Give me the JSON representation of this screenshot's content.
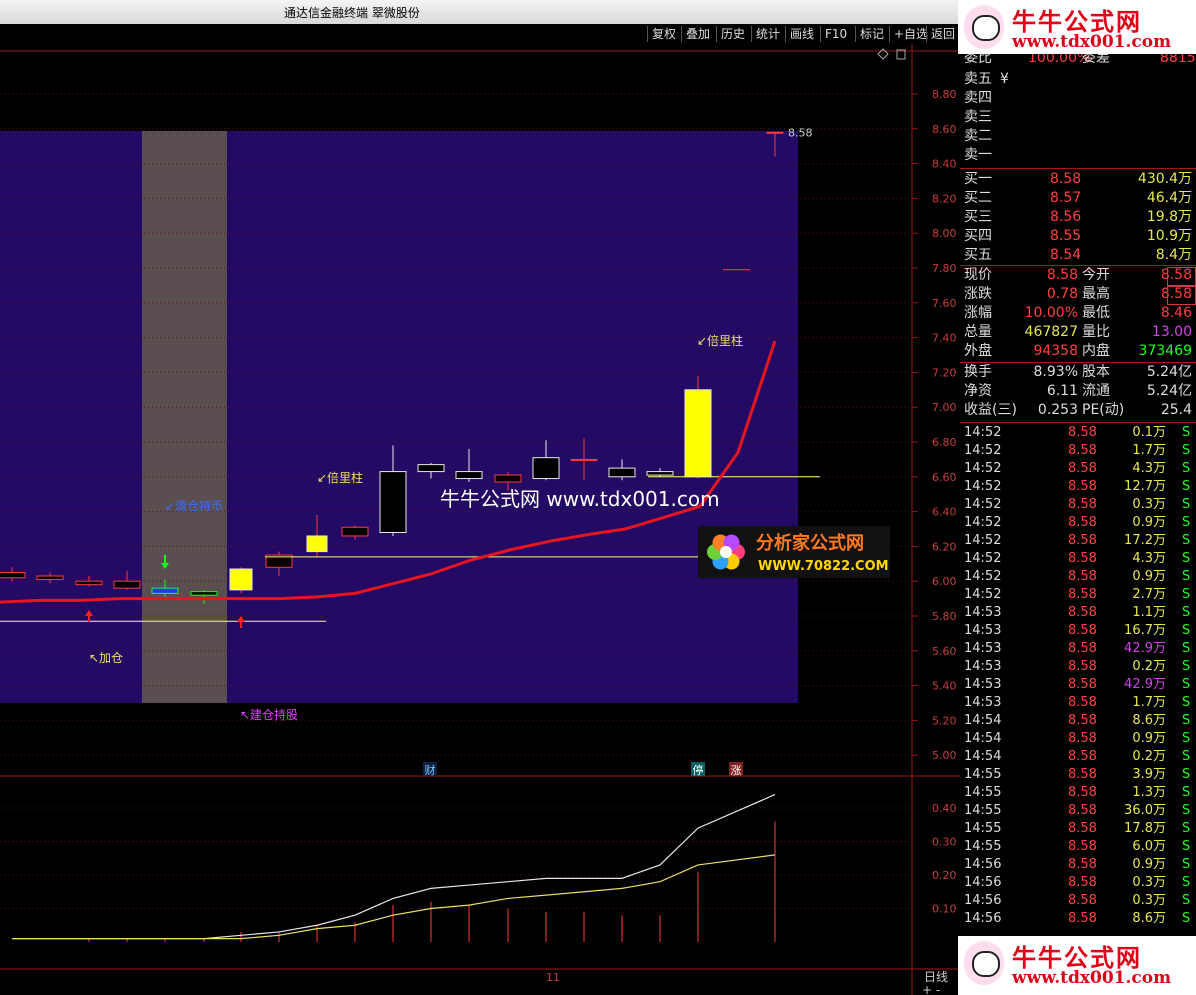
{
  "window": {
    "title": "通达信金融终端  翠微股份"
  },
  "toolbar": {
    "items": [
      "复权",
      "叠加",
      "历史",
      "统计",
      "画线",
      "F10",
      "标记",
      "+自选",
      "返回"
    ]
  },
  "price_axis": {
    "labels": [
      "8.80",
      "8.60",
      "8.40",
      "8.20",
      "8.00",
      "7.80",
      "7.60",
      "7.40",
      "7.20",
      "7.00",
      "6.80",
      "6.60",
      "6.40",
      "6.20",
      "6.00",
      "5.80",
      "5.60",
      "5.40",
      "5.20",
      "5.00"
    ]
  },
  "volume_axis": {
    "labels": [
      "0.40",
      "0.30",
      "0.20",
      "0.10"
    ]
  },
  "annotations": {
    "limit_price": "8.58",
    "bei_liang_zhu": "↙倍里柱",
    "bei_liang_zhu_2": "↙倍里柱",
    "qing_cang": "↙清仓持币",
    "jia_cang": "↖加仓",
    "jian_cang": "↖建仓持股",
    "watermark_url": "牛牛公式网 www.tdx001.com",
    "logo_name": "分析家公式网",
    "logo_url": "WWW.70822.COM",
    "marker_cai": "财",
    "marker_ting": "停",
    "marker_zhang": "涨",
    "date_label": "11",
    "bottom_tab": "日线",
    "bottom_symbols": "+  -"
  },
  "order_book": {
    "header": [
      "委比",
      "100.00%",
      "委差",
      "8815"
    ],
    "sell": [
      "卖五",
      "卖四",
      "卖三",
      "卖二",
      "卖一"
    ],
    "sell_extra": "¥",
    "buy": [
      {
        "label": "买一",
        "price": "8.58",
        "vol": "430.4万"
      },
      {
        "label": "买二",
        "price": "8.57",
        "vol": "46.4万"
      },
      {
        "label": "买三",
        "price": "8.56",
        "vol": "19.8万"
      },
      {
        "label": "买四",
        "price": "8.55",
        "vol": "10.9万"
      },
      {
        "label": "买五",
        "price": "8.54",
        "vol": "8.4万"
      }
    ]
  },
  "quote": [
    {
      "l1": "现价",
      "v1": "8.58",
      "l2": "今开",
      "v2": "8.58"
    },
    {
      "l1": "涨跌",
      "v1": "0.78",
      "l2": "最高",
      "v2": "8.58"
    },
    {
      "l1": "涨幅",
      "v1": "10.00%",
      "l2": "最低",
      "v2": "8.46"
    },
    {
      "l1": "总量",
      "v1": "467827",
      "l2": "量比",
      "v2": "13.00"
    },
    {
      "l1": "外盘",
      "v1": "94358",
      "l2": "内盘",
      "v2": "373469"
    }
  ],
  "fundamentals": [
    {
      "l1": "换手",
      "v1": "8.93%",
      "l2": "股本",
      "v2": "5.24亿"
    },
    {
      "l1": "净资",
      "v1": "6.11",
      "l2": "流通",
      "v2": "5.24亿"
    },
    {
      "l1": "收益(三)",
      "v1": "0.253",
      "l2": "PE(动)",
      "v2": "25.4"
    }
  ],
  "ticks": [
    [
      "14:52",
      "8.58",
      "0.1万",
      "S"
    ],
    [
      "14:52",
      "8.58",
      "1.7万",
      "S"
    ],
    [
      "14:52",
      "8.58",
      "4.3万",
      "S"
    ],
    [
      "14:52",
      "8.58",
      "12.7万",
      "S"
    ],
    [
      "14:52",
      "8.58",
      "0.3万",
      "S"
    ],
    [
      "14:52",
      "8.58",
      "0.9万",
      "S"
    ],
    [
      "14:52",
      "8.58",
      "17.2万",
      "S"
    ],
    [
      "14:52",
      "8.58",
      "4.3万",
      "S"
    ],
    [
      "14:52",
      "8.58",
      "0.9万",
      "S"
    ],
    [
      "14:52",
      "8.58",
      "2.7万",
      "S"
    ],
    [
      "14:53",
      "8.58",
      "1.1万",
      "S"
    ],
    [
      "14:53",
      "8.58",
      "16.7万",
      "S"
    ],
    [
      "14:53",
      "8.58",
      "42.9万",
      "S"
    ],
    [
      "14:53",
      "8.58",
      "0.2万",
      "S"
    ],
    [
      "14:53",
      "8.58",
      "42.9万",
      "S"
    ],
    [
      "14:53",
      "8.58",
      "1.7万",
      "S"
    ],
    [
      "14:54",
      "8.58",
      "8.6万",
      "S"
    ],
    [
      "14:54",
      "8.58",
      "0.9万",
      "S"
    ],
    [
      "14:54",
      "8.58",
      "0.2万",
      "S"
    ],
    [
      "14:55",
      "8.58",
      "3.9万",
      "S"
    ],
    [
      "14:55",
      "8.58",
      "1.3万",
      "S"
    ],
    [
      "14:55",
      "8.58",
      "36.0万",
      "S"
    ],
    [
      "14:55",
      "8.58",
      "17.8万",
      "S"
    ],
    [
      "14:55",
      "8.58",
      "6.0万",
      "S"
    ],
    [
      "14:56",
      "8.58",
      "0.9万",
      "S"
    ],
    [
      "14:56",
      "8.58",
      "0.3万",
      "S"
    ],
    [
      "14:56",
      "8.58",
      "0.3万",
      "S"
    ],
    [
      "14:56",
      "8.58",
      "8.6万",
      "S"
    ]
  ],
  "tick_highlight_indices": [
    12,
    14
  ],
  "watermark": {
    "brand": "牛牛公式网",
    "url": "www.tdx001.com"
  },
  "chart_data": {
    "type": "candlestick",
    "ylim": [
      4.95,
      8.9
    ],
    "candles": [
      {
        "o": 6.02,
        "c": 6.05,
        "h": 6.08,
        "l": 6.0
      },
      {
        "o": 6.01,
        "c": 6.03,
        "h": 6.05,
        "l": 5.99
      },
      {
        "o": 5.98,
        "c": 6.0,
        "h": 6.03,
        "l": 5.97
      },
      {
        "o": 5.96,
        "c": 6.0,
        "h": 6.06,
        "l": 5.95
      },
      {
        "o": 5.93,
        "c": 5.96,
        "h": 6.01,
        "l": 5.91
      },
      {
        "o": 5.92,
        "c": 5.94,
        "h": 5.95,
        "l": 5.87
      },
      {
        "o": 5.95,
        "c": 6.07,
        "h": 6.08,
        "l": 5.93
      },
      {
        "o": 6.08,
        "c": 6.15,
        "h": 6.17,
        "l": 6.03
      },
      {
        "o": 6.17,
        "c": 6.26,
        "h": 6.38,
        "l": 6.14
      },
      {
        "o": 6.26,
        "c": 6.31,
        "h": 6.32,
        "l": 6.24
      },
      {
        "o": 6.63,
        "c": 6.28,
        "h": 6.78,
        "l": 6.26
      },
      {
        "o": 6.67,
        "c": 6.63,
        "h": 6.68,
        "l": 6.59
      },
      {
        "o": 6.63,
        "c": 6.59,
        "h": 6.76,
        "l": 6.57
      },
      {
        "o": 6.57,
        "c": 6.61,
        "h": 6.63,
        "l": 6.52
      },
      {
        "o": 6.71,
        "c": 6.59,
        "h": 6.81,
        "l": 6.58
      },
      {
        "o": 6.7,
        "c": 6.7,
        "h": 6.82,
        "l": 6.58
      },
      {
        "o": 6.65,
        "c": 6.6,
        "h": 6.7,
        "l": 6.58
      },
      {
        "o": 6.63,
        "c": 6.61,
        "h": 6.65,
        "l": 6.6
      },
      {
        "o": 6.6,
        "c": 7.1,
        "h": 7.18,
        "l": 6.59
      },
      {
        "o": 8.58,
        "c": 8.58,
        "h": 8.58,
        "l": 8.46
      }
    ],
    "ma": [
      5.88,
      5.89,
      5.89,
      5.9,
      5.9,
      5.9,
      5.9,
      5.9,
      5.91,
      5.93,
      6.04,
      6.12,
      6.18,
      6.23,
      6.27,
      6.3,
      6.36,
      6.43,
      6.74,
      7.38
    ],
    "hlines": [
      6.14,
      6.6,
      5.77
    ],
    "volume_lines": {
      "white": [
        0.01,
        0.01,
        0.01,
        0.01,
        0.01,
        0.01,
        0.02,
        0.03,
        0.05,
        0.08,
        0.13,
        0.16,
        0.17,
        0.18,
        0.19,
        0.19,
        0.19,
        0.23,
        0.34,
        0.44
      ],
      "yellow": [
        0.01,
        0.01,
        0.01,
        0.01,
        0.01,
        0.01,
        0.01,
        0.02,
        0.04,
        0.05,
        0.08,
        0.1,
        0.11,
        0.13,
        0.14,
        0.15,
        0.16,
        0.18,
        0.23,
        0.26
      ],
      "bars": [
        0.0,
        0.0,
        0.01,
        0.01,
        0.01,
        0.01,
        0.03,
        0.03,
        0.05,
        0.06,
        0.11,
        0.12,
        0.11,
        0.1,
        0.09,
        0.09,
        0.08,
        0.08,
        0.21,
        0.36
      ]
    },
    "vlim": [
      0,
      0.45
    ]
  }
}
